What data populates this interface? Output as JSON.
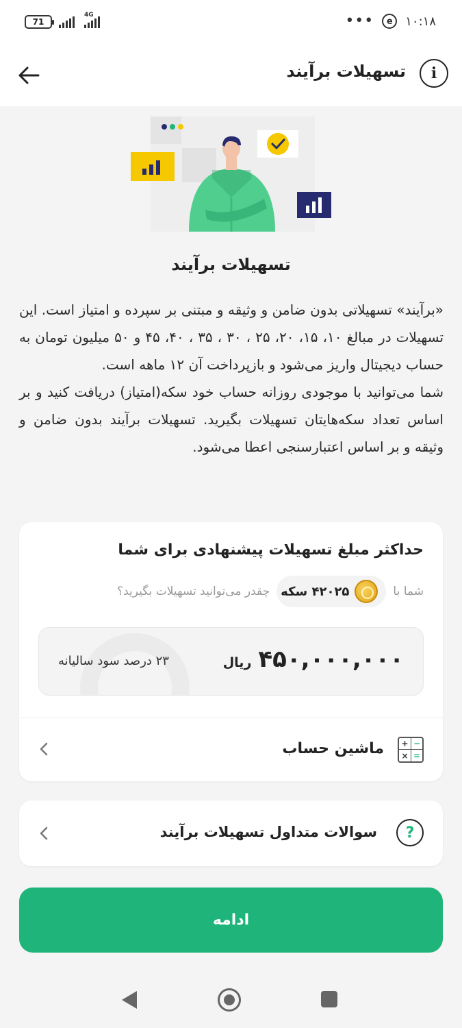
{
  "status_bar": {
    "battery": "71",
    "network": "4G",
    "time": "۱۰:۱۸",
    "dots": "•••",
    "app_badge": "e"
  },
  "header": {
    "title": "تسهیلات برآیند",
    "info_glyph": "i"
  },
  "section": {
    "title": "تسهیلات برآیند",
    "paragraph_1": "«برآیند» تسهیلاتی بدون ضامن و وثیقه و مبتنی بر سپرده و امتیاز است. این تسهیلات در مبالغ ۱۰، ۱۵، ۲۰، ۲۵ ، ۳۰ ، ۳۵ ، ۴۰، ۴۵ و ۵۰ میلیون تومان به حساب دیجیتال واریز می‌شود و بازپرداخت آن ۱۲ ماهه است.",
    "paragraph_2": "شما می‌توانید با موجودی روزانه حساب خود سکه(امتیاز) دریافت کنید و بر اساس تعداد سکه‌هایتان تسهیلات بگیرید. تسهیلات برآیند بدون ضامن و وثیقه و بر اساس اعتبارسنجی اعطا می‌شود."
  },
  "offer": {
    "title": "حداکثر مبلغ تسهیلات پیشنهادی برای شما",
    "prefix": "شما با",
    "coins": "۴۲۰۲۵ سکه",
    "suffix": "چقدر می‌توانید تسهیلات بگیرید؟",
    "amount": "۴۵۰,۰۰۰,۰۰۰",
    "unit": "ریال",
    "rate": "۲۳ درصد سود سالیانه",
    "calculator_label": "ماشین حساب"
  },
  "faq": {
    "label": "سوالات متداول تسهیلات برآیند",
    "icon_glyph": "?"
  },
  "continue_button": "ادامه",
  "icons": {
    "back": "arrow-left-icon",
    "info": "info-icon",
    "calculator": "calculator-icon",
    "faq": "question-icon",
    "chevron": "chevron-left-icon"
  },
  "colors": {
    "accent": "#1fb57a",
    "illustration_yellow": "#f5c800",
    "illustration_navy": "#252b6e"
  }
}
